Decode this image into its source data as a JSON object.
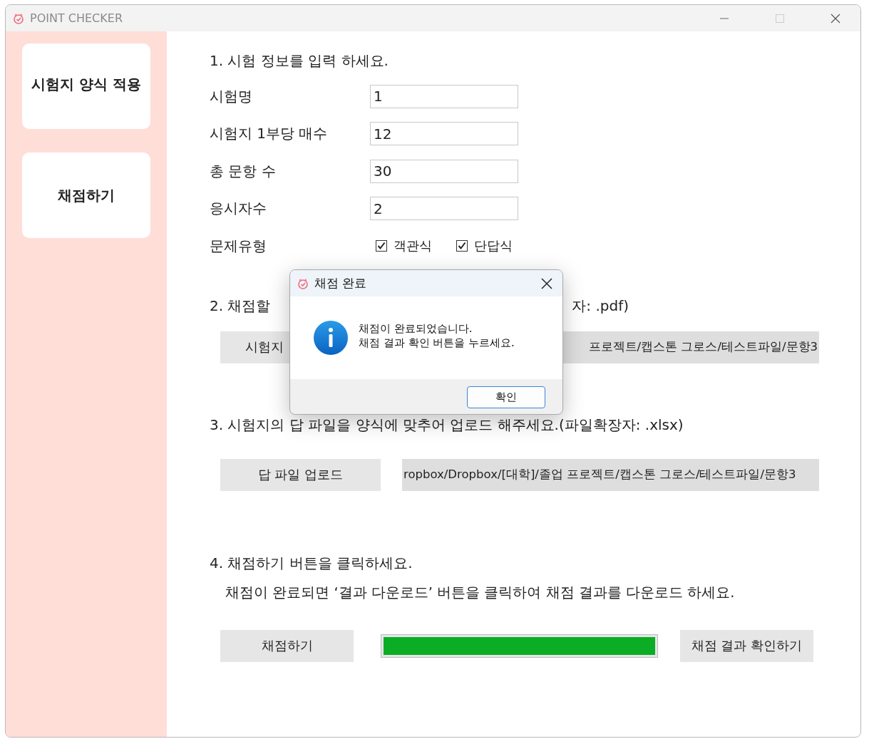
{
  "window": {
    "title": "POINT CHECKER"
  },
  "sidebar": {
    "items": [
      {
        "label": "시험지 양식 적용"
      },
      {
        "label": "채점하기"
      }
    ]
  },
  "step1": {
    "heading": "1. 시험 정보를 입력 하세요.",
    "fields": [
      {
        "label": "시험명",
        "value": "1"
      },
      {
        "label": "시험지 1부당 매수",
        "value": "12"
      },
      {
        "label": "총 문항 수",
        "value": "30"
      },
      {
        "label": "응시자수",
        "value": "2"
      }
    ],
    "question_types": {
      "label": "문제유형",
      "options": [
        {
          "label": "객관식",
          "checked": true
        },
        {
          "label": "단답식",
          "checked": true
        }
      ]
    }
  },
  "step2": {
    "heading_start": "2. 채점할",
    "heading_end": "자: .pdf)",
    "upload_button": "시험지",
    "file_path": "프로젝트/캡스톤 그로스/테스트파일/문항3"
  },
  "step3": {
    "heading": "3. 시험지의 답 파일을 양식에 맞추어 업로드 해주세요.(파일확장자: .xlsx)",
    "upload_button": "답 파일 업로드",
    "file_path": "ropbox/Dropbox/[대학]/졸업 프로젝트/캡스톤 그로스/테스트파일/문항3"
  },
  "step4": {
    "heading": "4. 채점하기 버튼을 클릭하세요.",
    "note": "채점이 완료되면 ‘결과 다운로드’ 버튼을 클릭하여 채점 결과를 다운로드 하세요.",
    "grade_button": "채점하기",
    "progress": {
      "level": 1
    },
    "result_button": "채점 결과 확인하기"
  },
  "dialog": {
    "title": "채점 완료",
    "lines": [
      "채점이 완료되었습니다.",
      "채점 결과 확인 버튼을 누르세요."
    ],
    "ok_button": "확인"
  }
}
